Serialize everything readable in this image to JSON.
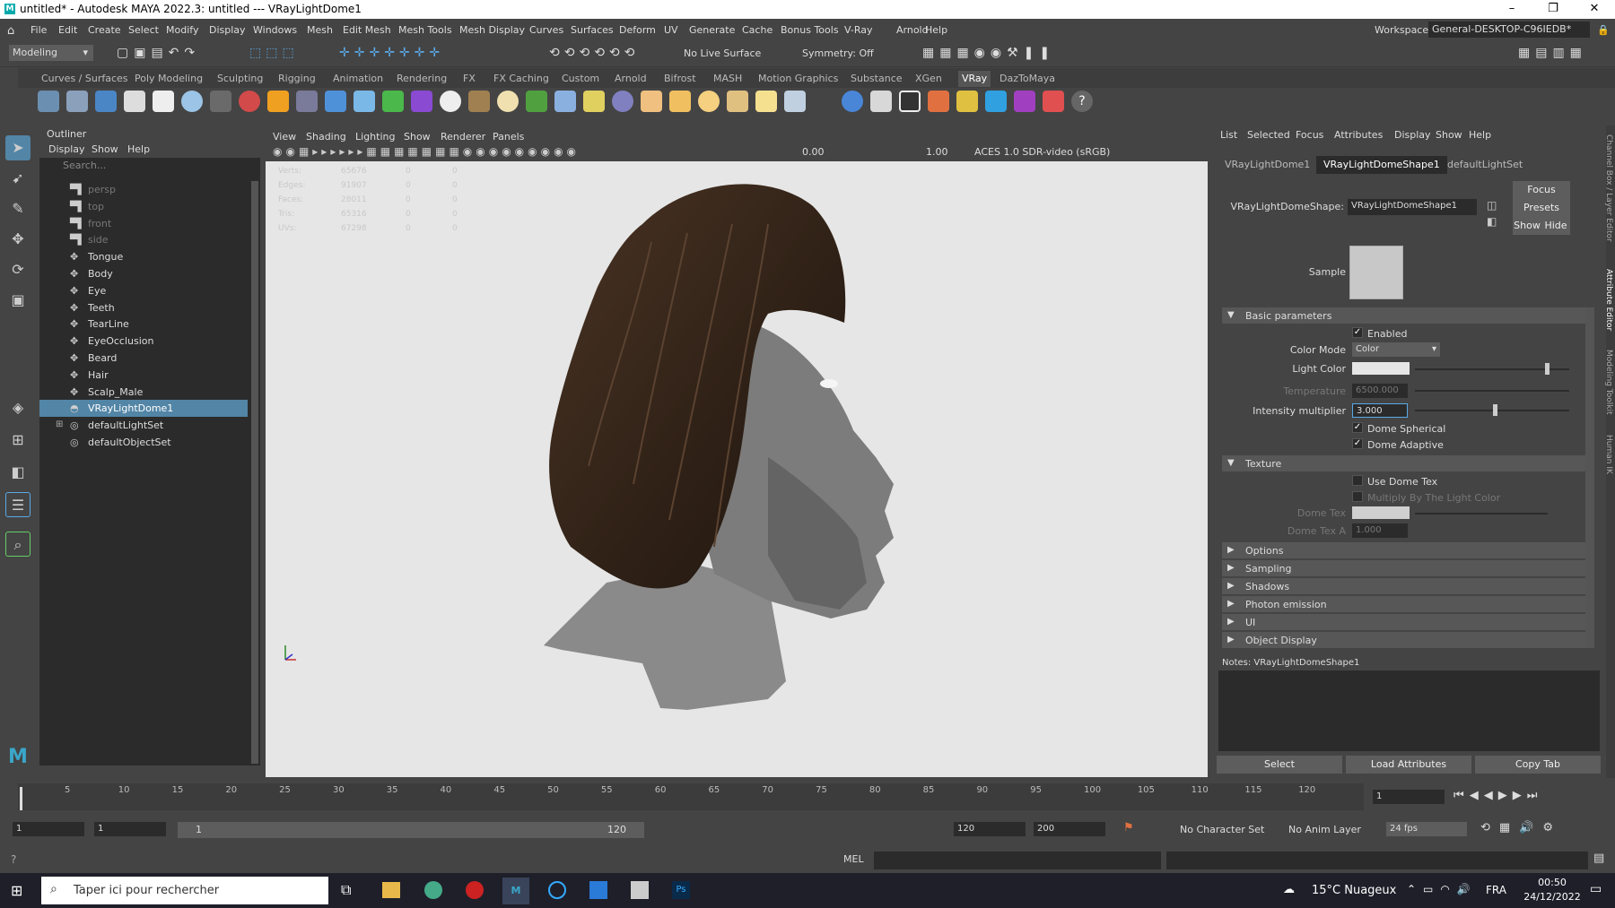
{
  "window": {
    "title": "untitled* - Autodesk MAYA 2022.3: untitled  ---  VRayLightDome1",
    "logo": "M"
  },
  "menu": [
    "File",
    "Edit",
    "Create",
    "Select",
    "Modify",
    "Display",
    "Windows",
    "Mesh",
    "Edit Mesh",
    "Mesh Tools",
    "Mesh Display",
    "Curves",
    "Surfaces",
    "Deform",
    "UV",
    "Generate",
    "Cache",
    "Bonus Tools",
    "V-Ray",
    "Arnold",
    "Help"
  ],
  "status": {
    "mode": "Modeling",
    "live_surface": "No Live Surface",
    "symmetry": "Symmetry: Off",
    "workspace_label": "Workspace:",
    "workspace_value": "General-DESKTOP-C96IEDB*"
  },
  "shelf_tabs": [
    "Curves / Surfaces",
    "Poly Modeling",
    "Sculpting",
    "Rigging",
    "Animation",
    "Rendering",
    "FX",
    "FX Caching",
    "Custom",
    "Arnold",
    "Bifrost",
    "MASH",
    "Motion Graphics",
    "Substance",
    "XGen",
    "VRay",
    "DazToMaya"
  ],
  "shelf_active": "VRay",
  "outliner": {
    "title": "Outliner",
    "menu": [
      "Display",
      "Show",
      "Help"
    ],
    "search_placeholder": "Search...",
    "items": [
      {
        "label": "persp",
        "icon": "camera-icon",
        "dim": true
      },
      {
        "label": "top",
        "icon": "camera-icon",
        "dim": true
      },
      {
        "label": "front",
        "icon": "camera-icon",
        "dim": true
      },
      {
        "label": "side",
        "icon": "camera-icon",
        "dim": true
      },
      {
        "label": "Tongue",
        "icon": "mesh-icon"
      },
      {
        "label": "Body",
        "icon": "mesh-icon"
      },
      {
        "label": "Eye",
        "icon": "mesh-icon"
      },
      {
        "label": "Teeth",
        "icon": "mesh-icon"
      },
      {
        "label": "TearLine",
        "icon": "mesh-icon"
      },
      {
        "label": "EyeOcclusion",
        "icon": "mesh-icon"
      },
      {
        "label": "Beard",
        "icon": "mesh-icon"
      },
      {
        "label": "Hair",
        "icon": "mesh-icon"
      },
      {
        "label": "Scalp_Male",
        "icon": "mesh-icon"
      },
      {
        "label": "VRayLightDome1",
        "icon": "dome-light-icon",
        "selected": true
      },
      {
        "label": "defaultLightSet",
        "icon": "set-icon",
        "expand": true
      },
      {
        "label": "defaultObjectSet",
        "icon": "set-icon"
      }
    ]
  },
  "viewport": {
    "menu": [
      "View",
      "Shading",
      "Lighting",
      "Show",
      "Renderer",
      "Panels"
    ],
    "near": "0.00",
    "far": "1.00",
    "colorspace": "ACES 1.0 SDR-video (sRGB)",
    "hud": [
      [
        "Verts:",
        "65676",
        "0",
        "0"
      ],
      [
        "Edges:",
        "91907",
        "0",
        "0"
      ],
      [
        "Faces:",
        "28011",
        "0",
        "0"
      ],
      [
        "Tris:",
        "65316",
        "0",
        "0"
      ],
      [
        "UVs:",
        "67298",
        "0",
        "0"
      ]
    ]
  },
  "attr": {
    "menu": [
      "List",
      "Selected",
      "Focus",
      "Attributes",
      "Display",
      "Show",
      "Help"
    ],
    "tabs": [
      "VRayLightDome1",
      "VRayLightDomeShape1",
      "defaultLightSet"
    ],
    "active_tab": 1,
    "shape_label": "VRayLightDomeShape:",
    "shape_value": "VRayLightDomeShape1",
    "focus": "Focus",
    "presets": "Presets",
    "show": "Show",
    "hide": "Hide",
    "sample_label": "Sample",
    "basic": "Basic parameters",
    "enabled": "Enabled",
    "color_mode_label": "Color Mode",
    "color_mode_value": "Color",
    "light_color": "Light Color",
    "temperature_label": "Temperature",
    "temperature_value": "6500.000",
    "intensity_label": "Intensity multiplier",
    "intensity_value": "3.000",
    "dome_spherical": "Dome Spherical",
    "dome_adaptive": "Dome Adaptive",
    "texture": "Texture",
    "use_dome_tex": "Use Dome Tex",
    "multiply": "Multiply By The Light Color",
    "dome_tex": "Dome Tex",
    "dome_tex_a": "Dome Tex A",
    "dome_tex_a_value": "1.000",
    "collapsed": [
      "Options",
      "Sampling",
      "Shadows",
      "Photon emission",
      "UI",
      "Object Display"
    ],
    "notes": "Notes:  VRayLightDomeShape1",
    "select": "Select",
    "load": "Load Attributes",
    "copy": "Copy Tab"
  },
  "side_tabs": [
    "Channel Box / Layer Editor",
    "Attribute Editor",
    "Modeling Toolkit",
    "Human IK"
  ],
  "timeline": {
    "ticks": [
      "5",
      "10",
      "15",
      "20",
      "25",
      "30",
      "35",
      "40",
      "45",
      "50",
      "55",
      "60",
      "65",
      "70",
      "75",
      "80",
      "85",
      "90",
      "95",
      "100",
      "105",
      "110",
      "115",
      "120"
    ],
    "current": "1"
  },
  "range": {
    "start": "1",
    "start2": "1",
    "slider_start": "1",
    "slider_end": "120",
    "end": "120",
    "end2": "200",
    "char_set": "No Character Set",
    "anim_layer": "No Anim Layer",
    "fps": "24 fps"
  },
  "cmd": {
    "lang": "MEL"
  },
  "taskbar": {
    "search": "Taper ici pour rechercher",
    "weather": "15°C  Nuageux",
    "lang": "FRA",
    "time": "00:50",
    "date": "24/12/2022"
  }
}
